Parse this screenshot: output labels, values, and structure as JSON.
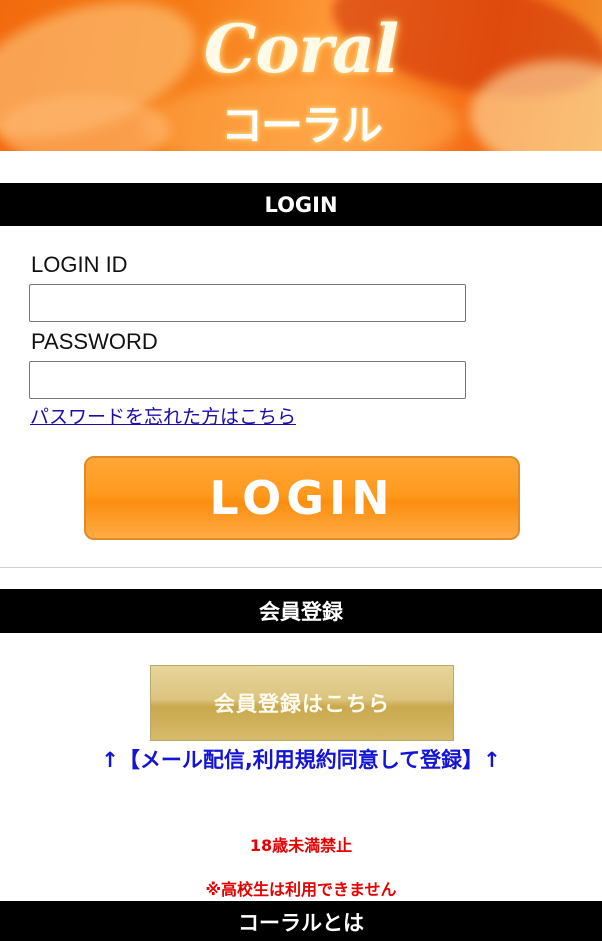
{
  "header": {
    "logo_en": "Coral",
    "logo_jp": "コーラル"
  },
  "login": {
    "section_title": "LOGIN",
    "id_label": "LOGIN ID",
    "id_value": "",
    "password_label": "PASSWORD",
    "password_value": "",
    "forgot_link": "パスワードを忘れた方はこちら",
    "button_label": "LOGIN"
  },
  "register": {
    "section_title": "会員登録",
    "button_label": "会員登録はこちら",
    "note": "↑【メール配信,利用規約同意して登録】↑",
    "age_notice": "18歳未満禁止",
    "high_school_notice": "※高校生は利用できません"
  },
  "about": {
    "section_title": "コーラルとは"
  },
  "colors": {
    "banner_orange": "#f26a0d",
    "login_button": "#ff9a1f",
    "register_button": "#d9be72",
    "link_blue": "#1a0dab",
    "note_blue": "#1414d6",
    "warning_red": "#e60000",
    "section_bar": "#000000"
  }
}
